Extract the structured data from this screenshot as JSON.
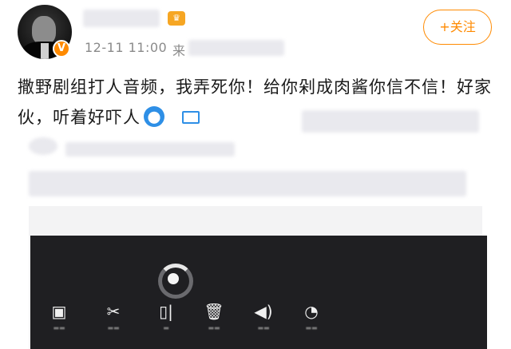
{
  "post": {
    "timestamp": "12-11 11:00",
    "source_prefix": "来",
    "follow_label": "+关注",
    "text": "撒野剧组打人音频，我弄死你！给你剁成肉酱你信不信！好家伙，听着好吓人"
  },
  "badges": {
    "verified": "V",
    "crown": "♛"
  },
  "video_toolbar": {
    "icons": [
      "crop-icon",
      "scissors-icon",
      "split-icon",
      "trash-icon",
      "volume-icon",
      "speed-icon"
    ],
    "glyphs": [
      "▣",
      "✂",
      "▯|",
      "🗑",
      "◀)",
      "◔"
    ]
  },
  "colors": {
    "accent": "#ff8a00",
    "link_blue": "#2e8fe6",
    "player_bg": "#1f1f22"
  }
}
